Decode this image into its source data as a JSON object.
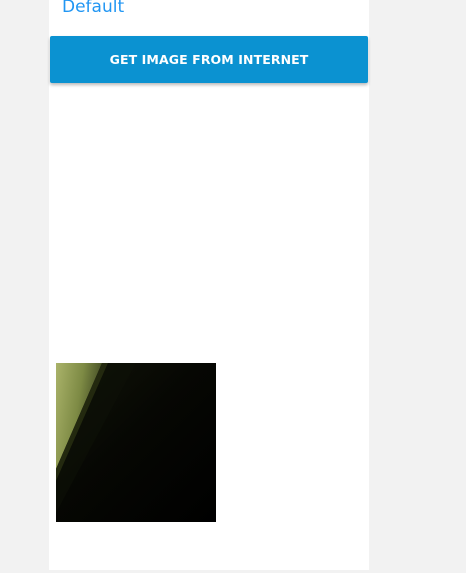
{
  "section": {
    "title": "Default"
  },
  "button": {
    "label": "GET IMAGE FROM INTERNET",
    "color": "#0b92d1"
  },
  "colors": {
    "accent": "#2196f3",
    "background": "#f2f2f2",
    "panel": "#ffffff"
  }
}
